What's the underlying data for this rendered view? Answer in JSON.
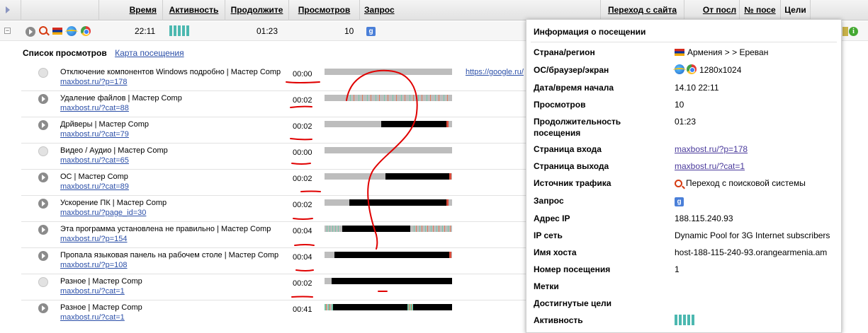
{
  "header": {
    "columns": {
      "time": "Время",
      "activity": "Активность",
      "duration": "Продолжите",
      "views": "Просмотров",
      "query": "Запрос",
      "referrer": "Переход с сайта",
      "from_last": "От посл",
      "visit_no": "№ посе",
      "goals": "Цели"
    }
  },
  "visit": {
    "time": "22:11",
    "duration": "01:23",
    "views": "10",
    "query_icon": "google-icon",
    "activity_bars": 5
  },
  "tabs": {
    "active": "Список просмотров",
    "map": "Карта посещения"
  },
  "pageviews": [
    {
      "title": "Отключение компонентов Windows подробно | Мастер Comp",
      "url": "maxbost.ru/?p=178",
      "time": "00:00",
      "referrer": "https://google.ru/"
    },
    {
      "title": "Удаление файлов | Мастер Comp",
      "url": "maxbost.ru/?cat=88",
      "time": "00:02"
    },
    {
      "title": "Дрйверы | Мастер Comp",
      "url": "maxbost.ru/?cat=79",
      "time": "00:02"
    },
    {
      "title": "Видео / Аудио | Мастер Comp",
      "url": "maxbost.ru/?cat=65",
      "time": "00:00"
    },
    {
      "title": "ОС | Мастер Comp",
      "url": "maxbost.ru/?cat=89",
      "time": "00:02"
    },
    {
      "title": "Ускорение ПК | Мастер Comp",
      "url": "maxbost.ru/?page_id=30",
      "time": "00:02"
    },
    {
      "title": "Эта программа установлена не правильно | Мастер Comp",
      "url": "maxbost.ru/?p=154",
      "time": "00:04"
    },
    {
      "title": "Пропала языковая панель на рабочем столе | Мастер Comp",
      "url": "maxbost.ru/?p=108",
      "time": "00:04"
    },
    {
      "title": "Разное | Мастер Comp",
      "url": "maxbost.ru/?cat=1",
      "time": "00:02"
    },
    {
      "title": "Разное | Мастер Comp",
      "url": "maxbost.ru/?cat=1",
      "time": "00:41"
    }
  ],
  "popup": {
    "title": "Информация о посещении",
    "rows": {
      "country": {
        "label": "Страна/регион",
        "value": "Армения > > Ереван"
      },
      "os": {
        "label": "ОС/браузер/экран",
        "value": "1280x1024"
      },
      "start": {
        "label": "Дата/время начала",
        "value": "14.10 22:11"
      },
      "views": {
        "label": "Просмотров",
        "value": "10"
      },
      "duration": {
        "label": "Продолжительность посещения",
        "value": "01:23"
      },
      "entry": {
        "label": "Страница входа",
        "value": "maxbost.ru/?p=178"
      },
      "exit": {
        "label": "Страница выхода",
        "value": "maxbost.ru/?cat=1"
      },
      "source": {
        "label": "Источник трафика",
        "value": "Переход с поисковой системы"
      },
      "query": {
        "label": "Запрос",
        "value": ""
      },
      "ip": {
        "label": "Адрес IP",
        "value": "188.115.240.93"
      },
      "network": {
        "label": "IP сеть",
        "value": "Dynamic Pool for 3G Internet subscribers"
      },
      "host": {
        "label": "Имя хоста",
        "value": "host-188-115-240-93.orangearmenia.am"
      },
      "visit_no": {
        "label": "Номер посещения",
        "value": "1"
      },
      "tags": {
        "label": "Метки",
        "value": ""
      },
      "goals": {
        "label": "Достигнутые цели",
        "value": ""
      },
      "activity": {
        "label": "Активность",
        "value": ""
      }
    }
  },
  "colors": {
    "accent_link": "#2b4fa8",
    "activity": "#4cb8b0",
    "annotation": "#e00000"
  }
}
